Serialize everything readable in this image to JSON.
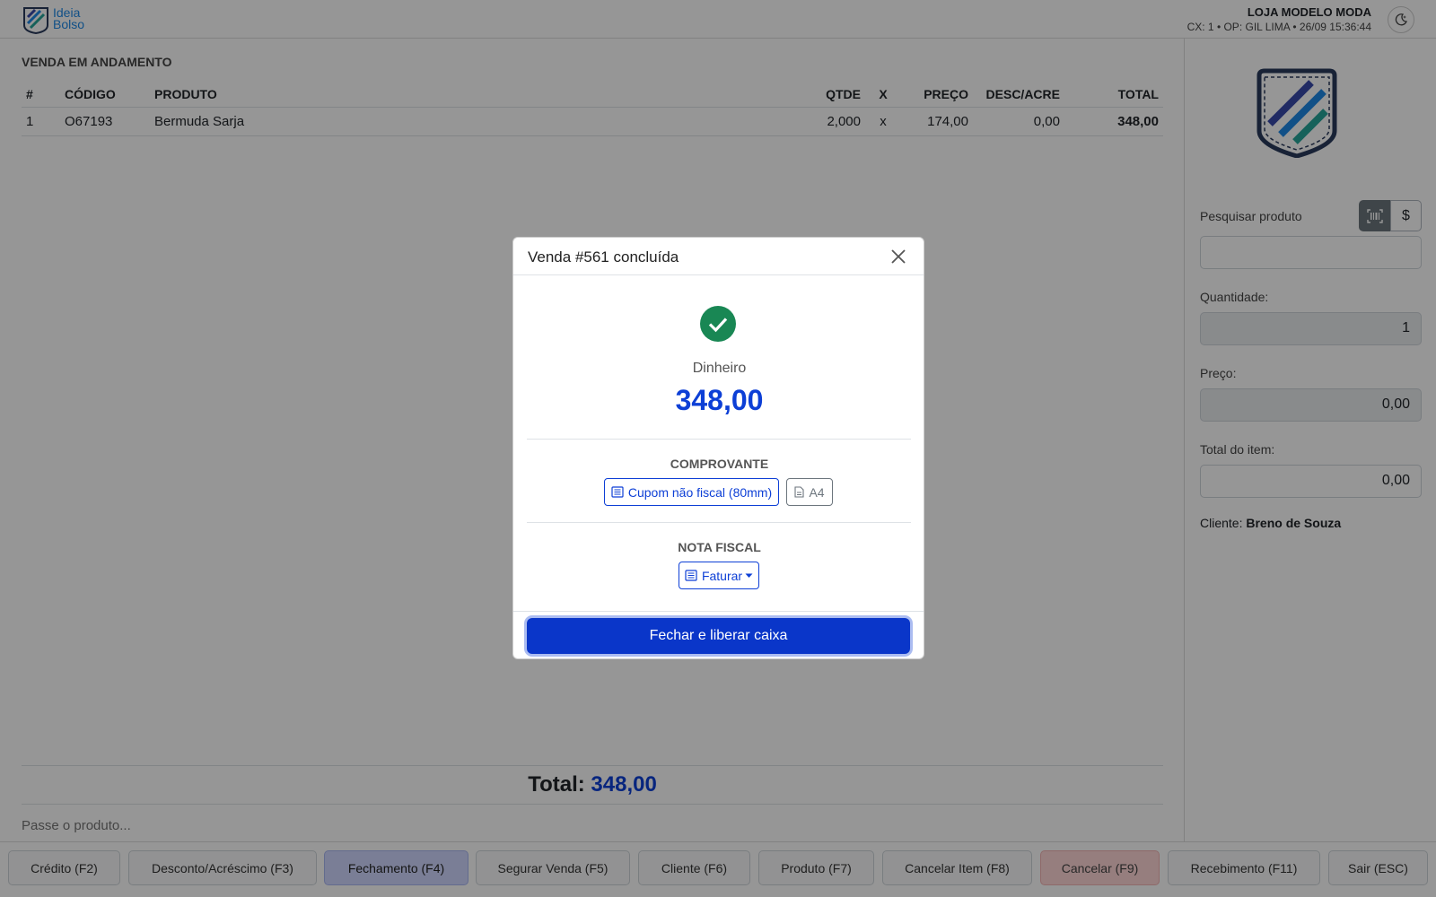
{
  "header": {
    "logo_line1": "Ideia",
    "logo_line2": "Bolso",
    "store_name": "LOJA MODELO MODA",
    "store_info": "CX: 1 • OP: GIL LIMA • 26/09 15:36:44"
  },
  "sale": {
    "section_title": "VENDA EM ANDAMENTO",
    "columns": [
      "#",
      "CÓDIGO",
      "PRODUTO",
      "QTDE",
      "X",
      "PREÇO",
      "DESC/ACRE",
      "TOTAL"
    ],
    "rows": [
      {
        "num": "1",
        "code": "O67193",
        "product": "Bermuda Sarja",
        "qty": "2,000",
        "x": "x",
        "price": "174,00",
        "disc": "0,00",
        "total": "348,00"
      }
    ],
    "total_label": "Total:",
    "total_value": "348,00",
    "scan_placeholder": "Passe o produto..."
  },
  "side": {
    "search_label": "Pesquisar produto",
    "search_value": "",
    "barcode_btn": "barcode-icon",
    "price_btn": "$",
    "qty_label": "Quantidade:",
    "qty_value": "1",
    "price_label": "Preço:",
    "price_value": "0,00",
    "item_total_label": "Total do item:",
    "item_total_value": "0,00",
    "client_label": "Cliente:",
    "client_name": "Breno de Souza"
  },
  "footer": {
    "buttons": [
      "Crédito (F2)",
      "Desconto/Acréscimo (F3)",
      "Fechamento (F4)",
      "Segurar Venda (F5)",
      "Cliente (F6)",
      "Produto (F7)",
      "Cancelar Item (F8)",
      "Cancelar (F9)",
      "Recebimento (F11)",
      "Sair (ESC)"
    ]
  },
  "modal": {
    "title": "Venda #561 concluída",
    "method": "Dinheiro",
    "amount": "348,00",
    "receipt_label": "COMPROVANTE",
    "receipt_btn": "Cupom não fiscal (80mm)",
    "a4_btn": "A4",
    "invoice_label": "NOTA FISCAL",
    "invoice_btn": "Faturar",
    "close_cash_btn": "Fechar e liberar caixa"
  },
  "colors": {
    "accent": "#0d3fd6",
    "success": "#198754"
  }
}
